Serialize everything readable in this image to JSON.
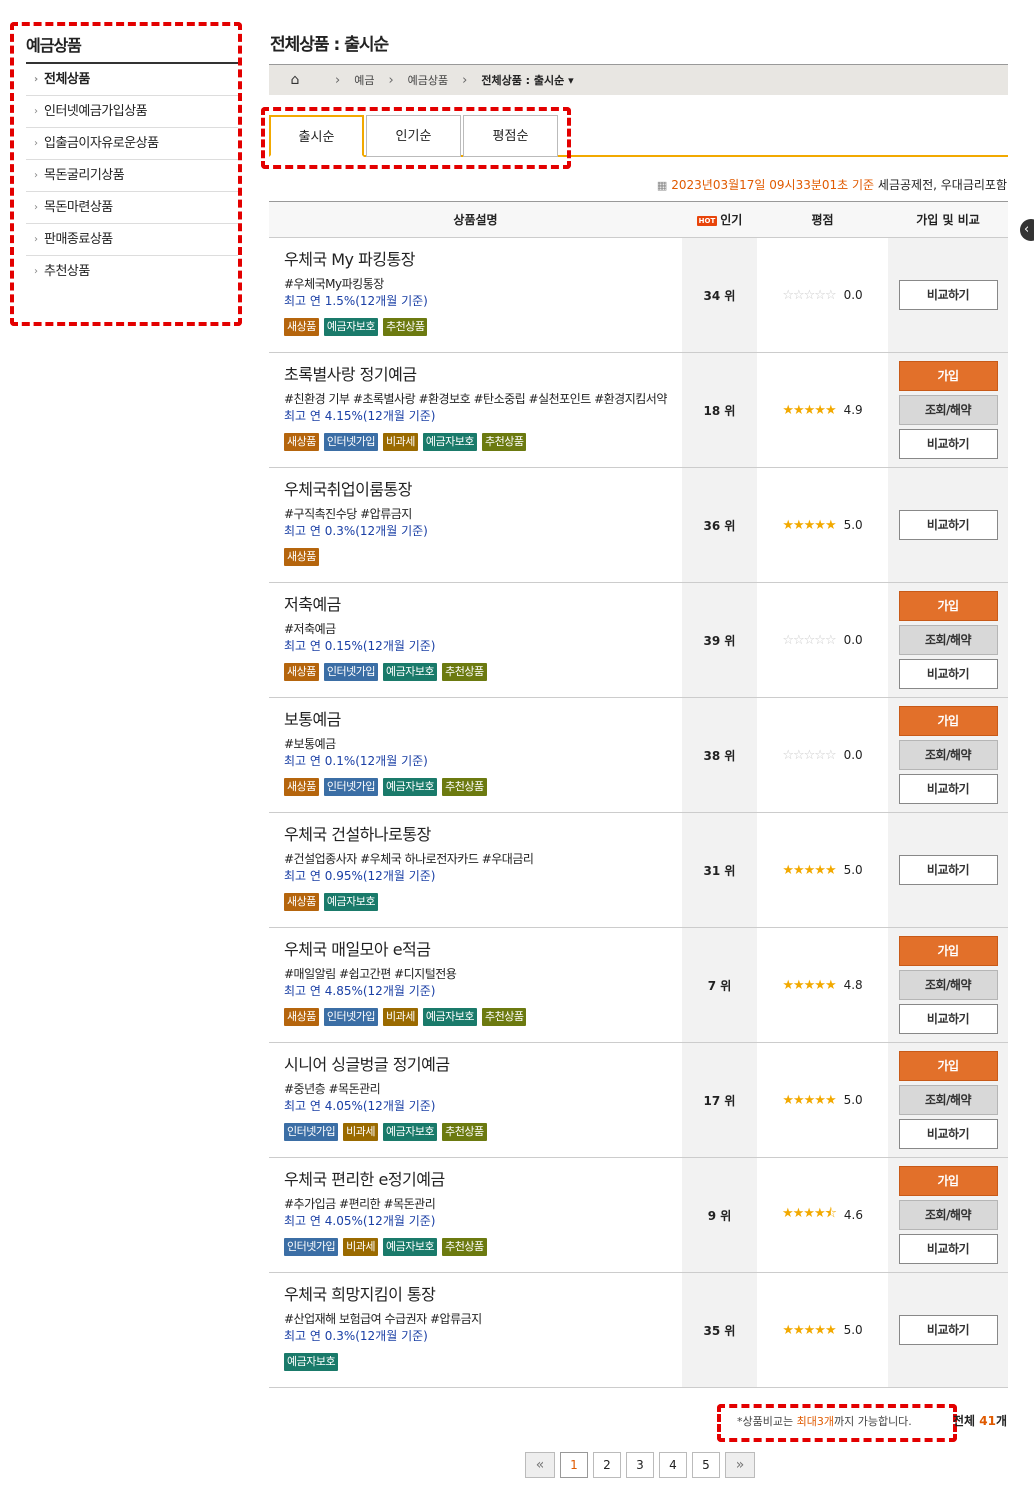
{
  "sidebar": {
    "title": "예금상품",
    "items": [
      {
        "label": "전체상품",
        "active": true
      },
      {
        "label": "인터넷예금가입상품"
      },
      {
        "label": "입출금이자유로운상품"
      },
      {
        "label": "목돈굴리기상품"
      },
      {
        "label": "목돈마련상품"
      },
      {
        "label": "판매종료상품"
      },
      {
        "label": "추천상품"
      }
    ]
  },
  "header": {
    "title": "전체상품 : 출시순",
    "breadcrumb": [
      "예금",
      "예금상품",
      "전체상품 : 출시순"
    ]
  },
  "tabs": [
    "출시순",
    "인기순",
    "평점순"
  ],
  "basis": {
    "date": "2023년03월17일 09시33분01초 기준",
    "suffix": "세금공제전, 우대금리포함"
  },
  "table": {
    "headers": {
      "desc": "상품설명",
      "hot": "HOT",
      "pop": "인기",
      "rating": "평점",
      "action": "가입 및 비교"
    },
    "buttons": {
      "join": "가입",
      "view": "조회/해약",
      "compare": "비교하기"
    },
    "rows": [
      {
        "name": "우체국 My 파킹통장",
        "tags": "#우체국My파킹통장",
        "rate": "최고 연 1.5%(12개월 기준)",
        "badges": [
          "새상품",
          "예금자보호",
          "추천상품"
        ],
        "rank": "34 위",
        "score": "0.0",
        "stars": 0,
        "join": false
      },
      {
        "name": "초록별사랑 정기예금",
        "tags": "#친환경 기부 #초록별사랑 #환경보호 #탄소중립 #실천포인트 #환경지킴서약",
        "rate": "최고 연 4.15%(12개월 기준)",
        "badges": [
          "새상품",
          "인터넷가입",
          "비과세",
          "예금자보호",
          "추천상품"
        ],
        "rank": "18 위",
        "score": "4.9",
        "stars": 5,
        "join": true
      },
      {
        "name": "우체국취업이룸통장",
        "tags": "#구직촉진수당 #압류금지",
        "rate": "최고 연 0.3%(12개월 기준)",
        "badges": [
          "새상품"
        ],
        "rank": "36 위",
        "score": "5.0",
        "stars": 5,
        "join": false
      },
      {
        "name": "저축예금",
        "tags": "#저축예금",
        "rate": "최고 연 0.15%(12개월 기준)",
        "badges": [
          "새상품",
          "인터넷가입",
          "예금자보호",
          "추천상품"
        ],
        "rank": "39 위",
        "score": "0.0",
        "stars": 0,
        "join": true
      },
      {
        "name": "보통예금",
        "tags": "#보통예금",
        "rate": "최고 연 0.1%(12개월 기준)",
        "badges": [
          "새상품",
          "인터넷가입",
          "예금자보호",
          "추천상품"
        ],
        "rank": "38 위",
        "score": "0.0",
        "stars": 0,
        "join": true
      },
      {
        "name": "우체국 건설하나로통장",
        "tags": "#건설업종사자 #우체국 하나로전자카드 #우대금리",
        "rate": "최고 연 0.95%(12개월 기준)",
        "badges": [
          "새상품",
          "예금자보호"
        ],
        "rank": "31 위",
        "score": "5.0",
        "stars": 5,
        "join": false
      },
      {
        "name": "우체국 매일모아 e적금",
        "tags": "#매일알림 #쉽고간편 #디지털전용",
        "rate": "최고 연 4.85%(12개월 기준)",
        "badges": [
          "새상품",
          "인터넷가입",
          "비과세",
          "예금자보호",
          "추천상품"
        ],
        "rank": "7 위",
        "score": "4.8",
        "stars": 5,
        "join": true
      },
      {
        "name": "시니어 싱글벙글 정기예금",
        "tags": "#중년층 #목돈관리",
        "rate": "최고 연 4.05%(12개월 기준)",
        "badges": [
          "인터넷가입",
          "비과세",
          "예금자보호",
          "추천상품"
        ],
        "rank": "17 위",
        "score": "5.0",
        "stars": 5,
        "join": true
      },
      {
        "name": "우체국 편리한 e정기예금",
        "tags": "#추가입금 #편리한 #목돈관리",
        "rate": "최고 연 4.05%(12개월 기준)",
        "badges": [
          "인터넷가입",
          "비과세",
          "예금자보호",
          "추천상품"
        ],
        "rank": "9 위",
        "score": "4.6",
        "stars": 4.5,
        "join": true
      },
      {
        "name": "우체국 희망지킴이 통장",
        "tags": "#산업재해 보험급여 수급권자 #압류금지",
        "rate": "최고 연 0.3%(12개월 기준)",
        "badges": [
          "예금자보호"
        ],
        "rank": "35 위",
        "score": "5.0",
        "stars": 5,
        "join": false
      }
    ]
  },
  "footer": {
    "note_prefix": "*상품비교는 ",
    "note_highlight": "최대3개",
    "note_suffix": "까지 가능합니다.",
    "total_label": "전체 ",
    "total_num": "41",
    "total_unit": "개"
  },
  "pager": {
    "pages": [
      "1",
      "2",
      "3",
      "4",
      "5"
    ],
    "current": "1",
    "prev": "«",
    "next": "»"
  },
  "colors": {
    "accent": "#f2a900",
    "join": "#e2702a",
    "highlight": "#e05a00",
    "rate": "#1a3fa5"
  }
}
